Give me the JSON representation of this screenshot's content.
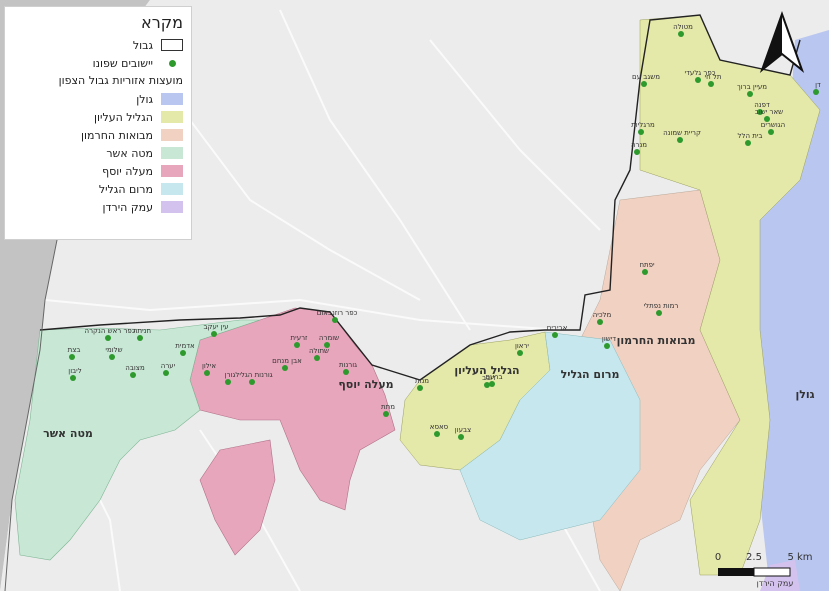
{
  "legend": {
    "title": "מקרא",
    "border_label": "גבול",
    "settlements_label": "יישובים שפונו",
    "councils_title": "מועצות אזוריות גבול הצפון",
    "councils": [
      {
        "name": "גולן",
        "color": "#b9c6ef"
      },
      {
        "name": "הגליל העליון",
        "color": "#e4e8a8"
      },
      {
        "name": "מבואות החרמון",
        "color": "#f1d1c2"
      },
      {
        "name": "מטה אשר",
        "color": "#c8e8d5"
      },
      {
        "name": "מעלה יוסף",
        "color": "#e8a6bd"
      },
      {
        "name": "מרום הגליל",
        "color": "#c7e7ee"
      },
      {
        "name": "עמק הירדן",
        "color": "#d4c2ee"
      }
    ]
  },
  "region_labels": {
    "mate_asher": "מטה אשר",
    "maale_yosef": "מעלה יוסף",
    "galil_elyon": "הגליל העליון",
    "merom_galil": "מרום הגליל",
    "mevoot_hermon": "מבואות החרמון",
    "golan": "גולן",
    "emek_hayarden": "עמק הירדן"
  },
  "settlements": [
    "כפר ראש הנקרה",
    "חניתה",
    "עין יעקב",
    "שלומי",
    "בצת",
    "אדמית",
    "גורן",
    "ליבון",
    "מצובה",
    "אילון",
    "יערה",
    "גורנות הגליל",
    "אבן מנחם",
    "שתולה",
    "זרעית",
    "כפר רוזנבאום",
    "שומרה",
    "מתת",
    "גורנות",
    "מנות",
    "דובב",
    "ברעם",
    "סאסא",
    "צבעון",
    "יראון",
    "מלכיה",
    "אביבים",
    "דישון",
    "יפתח",
    "רמות נפתלי",
    "מרגליות",
    "משגב עם",
    "כפר גלעדי",
    "קריית שמונה",
    "מנרה",
    "תל חי",
    "דפנה",
    "שאר ישוב",
    "הגושרים",
    "בית הלל",
    "דן",
    "מעיין ברוך",
    "מטולה"
  ],
  "scale": {
    "zero": "0",
    "mid": "2.5",
    "end": "5 km",
    "unit_note": "עמק הירדן"
  },
  "north": "N"
}
